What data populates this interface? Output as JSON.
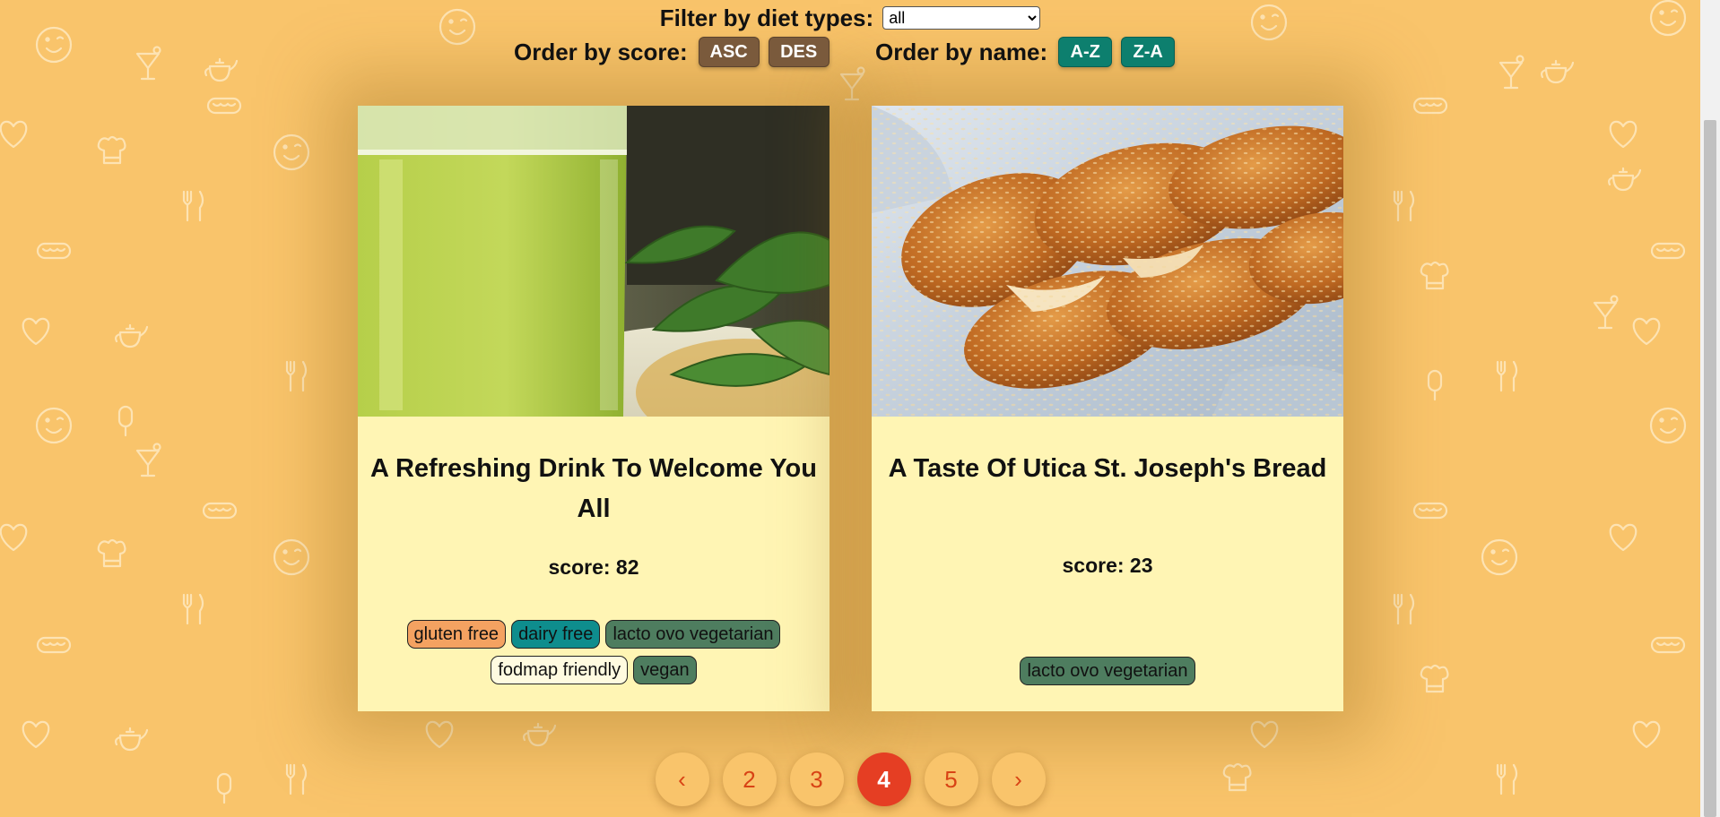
{
  "filter": {
    "label": "Filter by diet types:",
    "selected": "all"
  },
  "order_score": {
    "label": "Order by score:",
    "asc": "ASC",
    "des": "DES"
  },
  "order_name": {
    "label": "Order by name:",
    "az": "A-Z",
    "za": "Z-A"
  },
  "recipes": [
    {
      "title": "A Refreshing Drink To Welcome You All",
      "score_label": "score: 82",
      "tags": [
        "gluten free",
        "dairy free",
        "lacto ovo vegetarian",
        "fodmap friendly",
        "vegan"
      ]
    },
    {
      "title": "A Taste Of Utica St. Joseph's Bread",
      "score_label": "score: 23",
      "tags": [
        "lacto ovo vegetarian"
      ]
    }
  ],
  "pagination": {
    "prev": "‹",
    "pages": [
      "2",
      "3",
      "4",
      "5"
    ],
    "current": "4",
    "next": "›"
  },
  "colors": {
    "background": "#f9c46b",
    "card": "#fff5b4",
    "score_button": "#7a5a3c",
    "name_button": "#0d7f6e",
    "active_page": "#e53e23",
    "page_text": "#d84315",
    "tag_gluten_free": "#f4a261",
    "tag_dairy_free": "#0e8d8d",
    "tag_vegetarian": "#4e7d5f"
  },
  "icons": [
    "smiley-icon",
    "cocktail-icon",
    "teapot-icon",
    "hotdog-icon",
    "heart-icon",
    "chef-hat-icon",
    "fork-knife-icon",
    "popsicle-icon"
  ]
}
